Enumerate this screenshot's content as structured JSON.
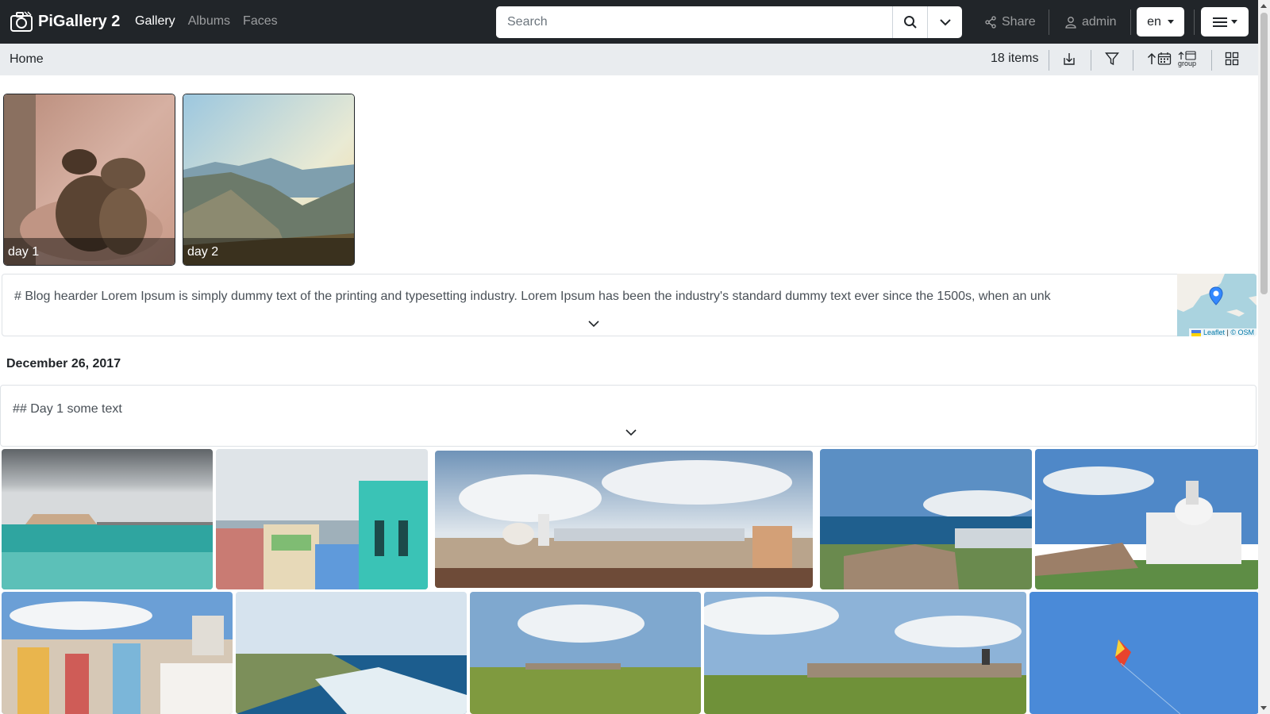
{
  "navbar": {
    "brand": "PiGallery 2",
    "links": [
      {
        "label": "Gallery",
        "active": true
      },
      {
        "label": "Albums",
        "active": false
      },
      {
        "label": "Faces",
        "active": false
      }
    ],
    "search_placeholder": "Search",
    "share_label": "Share",
    "user_label": "admin",
    "language": "en"
  },
  "subbar": {
    "breadcrumb": "Home",
    "item_count": "18 items",
    "group_label": "group"
  },
  "albums": [
    {
      "name": "day 1"
    },
    {
      "name": "day 2"
    }
  ],
  "blog_header": {
    "text": "# Blog hearder Lorem Ipsum is simply dummy text of the printing and typesetting industry. Lorem Ipsum has been the industry's standard dummy text ever since the 1500s, when an unk"
  },
  "map_attribution": {
    "leaflet": "Leaflet",
    "separator": "|",
    "osm": "© OSM"
  },
  "date_section": {
    "date": "December 26, 2017",
    "blog_text": "## Day 1 some text"
  },
  "colors": {
    "navbar_bg": "#212529",
    "subbar_bg": "#e9ecef",
    "accent": "#0d6efd"
  }
}
